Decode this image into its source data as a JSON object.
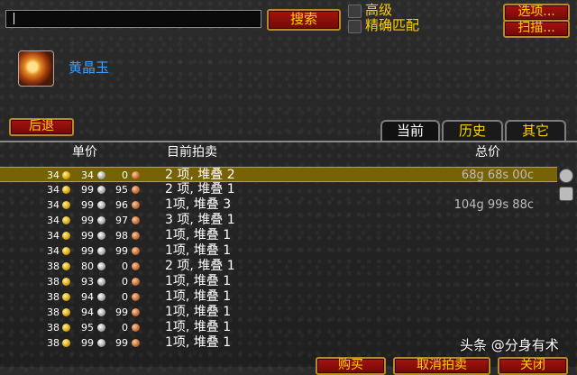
{
  "search": {
    "value": "",
    "button": "搜索"
  },
  "options": {
    "advanced": "高级",
    "exact_match": "精确匹配",
    "options_button": "选项...",
    "scan_button": "扫描..."
  },
  "item": {
    "name": "黄晶玉",
    "icon": "topaz-gem-icon"
  },
  "back_button": "后退",
  "tabs": [
    "当前",
    "历史",
    "其它"
  ],
  "columns": {
    "unit_price": "单价",
    "current": "目前拍卖",
    "total": "总价"
  },
  "rows": [
    {
      "g": "34",
      "s": "34",
      "c": "0",
      "current": "2 项, 堆叠 2",
      "total": "68g 68s 00c",
      "selected": true
    },
    {
      "g": "34",
      "s": "99",
      "c": "95",
      "current": "2 项, 堆叠 1",
      "total": ""
    },
    {
      "g": "34",
      "s": "99",
      "c": "96",
      "current": "1项, 堆叠 3",
      "total": "104g 99s 88c"
    },
    {
      "g": "34",
      "s": "99",
      "c": "97",
      "current": "3 项, 堆叠 1",
      "total": ""
    },
    {
      "g": "34",
      "s": "99",
      "c": "98",
      "current": "1项, 堆叠 1",
      "total": ""
    },
    {
      "g": "34",
      "s": "99",
      "c": "99",
      "current": "1项, 堆叠 1",
      "total": ""
    },
    {
      "g": "38",
      "s": "80",
      "c": "0",
      "current": "2 项, 堆叠 1",
      "total": ""
    },
    {
      "g": "38",
      "s": "93",
      "c": "0",
      "current": "1项, 堆叠 1",
      "total": ""
    },
    {
      "g": "38",
      "s": "94",
      "c": "0",
      "current": "1项, 堆叠 1",
      "total": ""
    },
    {
      "g": "38",
      "s": "94",
      "c": "99",
      "current": "1项, 堆叠 1",
      "total": ""
    },
    {
      "g": "38",
      "s": "95",
      "c": "0",
      "current": "1项, 堆叠 1",
      "total": ""
    },
    {
      "g": "38",
      "s": "99",
      "c": "99",
      "current": "1项, 堆叠 1",
      "total": ""
    }
  ],
  "bottom_buttons": {
    "buy": "购买",
    "cancel": "取消拍卖",
    "close": "关闭"
  },
  "watermark": "头条 @分身有术",
  "colors": {
    "accent_gold": "#ffd100",
    "button_red": "#8b0f0b",
    "selected_row": "#756305",
    "item_name": "#3da0ff"
  }
}
